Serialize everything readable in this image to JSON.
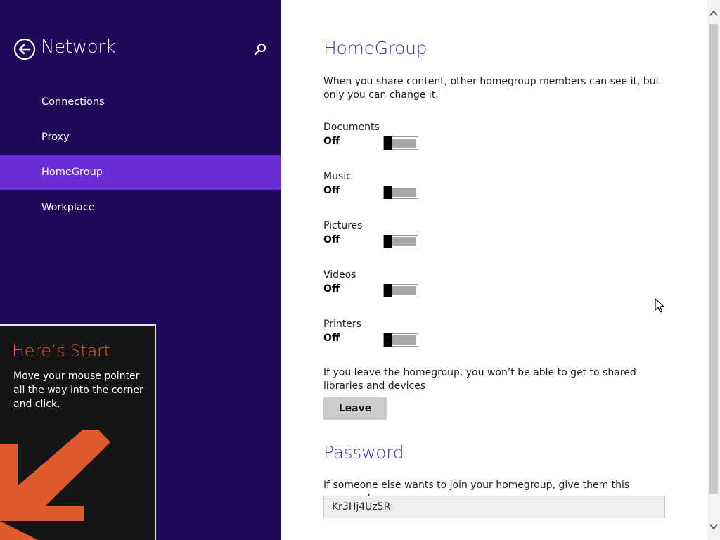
{
  "left_pane": {
    "title": "Network",
    "nav_items": [
      {
        "label": "Connections",
        "selected": false
      },
      {
        "label": "Proxy",
        "selected": false
      },
      {
        "label": "HomeGroup",
        "selected": true
      },
      {
        "label": "Workplace",
        "selected": false
      }
    ],
    "start_tip": {
      "title": "Here’s Start",
      "body": "Move your mouse pointer all the way into the corner and click."
    }
  },
  "main": {
    "homegroup_heading": "HomeGroup",
    "share_description": "When you share content, other homegroup members can see it, but only you can change it.",
    "toggles": [
      {
        "label": "Documents",
        "state": "Off"
      },
      {
        "label": "Music",
        "state": "Off"
      },
      {
        "label": "Pictures",
        "state": "Off"
      },
      {
        "label": "Videos",
        "state": "Off"
      },
      {
        "label": "Printers",
        "state": "Off"
      }
    ],
    "leave_description": "If you leave the homegroup, you won’t be able to get to shared libraries and devices",
    "leave_button": "Leave",
    "password_heading": "Password",
    "password_description": "If someone else wants to join your homegroup, give them this password",
    "password_value": "Kr3Hj4Uz5R"
  },
  "colors": {
    "left_pane_bg": "#1f0a5a",
    "selected_item_bg": "#6a2ed6",
    "heading_accent": "#4c2fa6",
    "tip_title": "#e05a2e"
  },
  "icons": {
    "back": "back-arrow-circle-icon",
    "search": "search-icon",
    "tip_arrow": "down-left-arrow-icon"
  }
}
